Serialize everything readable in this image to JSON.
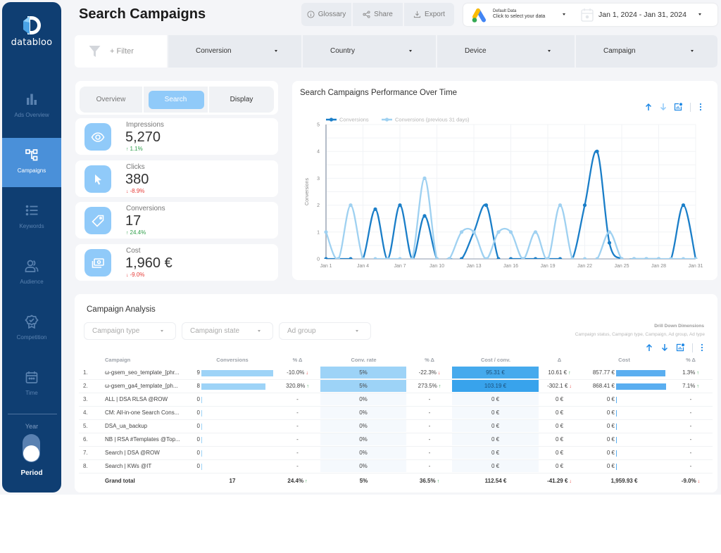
{
  "app": {
    "logo_text": "databloo"
  },
  "sidebar": {
    "items": [
      {
        "label": "Ads Overview",
        "icon": "bar-chart-icon",
        "active": false
      },
      {
        "label": "Campaigns",
        "icon": "hierarchy-icon",
        "active": true
      },
      {
        "label": "Keywords",
        "icon": "list-icon",
        "active": false
      },
      {
        "label": "Audience",
        "icon": "users-icon",
        "active": false
      },
      {
        "label": "Competition",
        "icon": "award-badge-icon",
        "active": false
      },
      {
        "label": "Time",
        "icon": "calendar-icon",
        "active": false
      }
    ],
    "toggle": {
      "top_label": "Year",
      "bottom_label": "Period",
      "selected": "Period"
    }
  },
  "header": {
    "title": "Search Campaigns",
    "buttons": [
      {
        "label": "Glossary",
        "icon": "info-icon"
      },
      {
        "label": "Share",
        "icon": "share-icon"
      },
      {
        "label": "Export",
        "icon": "download-icon"
      }
    ],
    "data_source": {
      "title": "Default Data",
      "subtitle": "Click to select your data",
      "icon": "google-ads-icon"
    },
    "date_range": "Jan 1, 2024 - Jan 31, 2024"
  },
  "filters": {
    "add_filter": "+ Filter",
    "dropdowns": [
      "Conversion",
      "Country",
      "Device",
      "Campaign"
    ]
  },
  "tabs": {
    "items": [
      "Overview",
      "Search",
      "Display"
    ],
    "active": "Search"
  },
  "scorecards": [
    {
      "label": "Impressions",
      "value": "5,270",
      "delta": "1.1%",
      "direction": "up",
      "icon": "eye-icon"
    },
    {
      "label": "Clicks",
      "value": "380",
      "delta": "-8.9%",
      "direction": "down",
      "icon": "cursor-icon"
    },
    {
      "label": "Conversions",
      "value": "17",
      "delta": "24.4%",
      "direction": "up",
      "icon": "tag-icon"
    },
    {
      "label": "Cost",
      "value": "1,960 €",
      "delta": "-9.0%",
      "direction": "down",
      "icon": "money-icon"
    }
  ],
  "chart_data": {
    "type": "line",
    "title": "Search Campaigns Performance Over Time",
    "xlabel": "",
    "ylabel": "Conversions",
    "x": [
      "Jan 1",
      "Jan 2",
      "Jan 3",
      "Jan 4",
      "Jan 5",
      "Jan 6",
      "Jan 7",
      "Jan 8",
      "Jan 9",
      "Jan 10",
      "Jan 11",
      "Jan 12",
      "Jan 13",
      "Jan 14",
      "Jan 15",
      "Jan 16",
      "Jan 17",
      "Jan 18",
      "Jan 19",
      "Jan 20",
      "Jan 21",
      "Jan 22",
      "Jan 23",
      "Jan 24",
      "Jan 25",
      "Jan 26",
      "Jan 27",
      "Jan 28",
      "Jan 29",
      "Jan 30",
      "Jan 31"
    ],
    "x_tick_labels": [
      "Jan 1",
      "Jan 4",
      "Jan 7",
      "Jan 10",
      "Jan 13",
      "Jan 16",
      "Jan 19",
      "Jan 22",
      "Jan 25",
      "Jan 28",
      "Jan 31"
    ],
    "y_ticks": [
      0,
      1,
      2,
      3,
      4,
      5
    ],
    "ylim": [
      0,
      5
    ],
    "grid": true,
    "legend": "top-left",
    "series": [
      {
        "name": "Conversions",
        "color": "#1a7ec8",
        "values": [
          0,
          0,
          0,
          0,
          1.85,
          0,
          2,
          0,
          1.6,
          0,
          0,
          0,
          1,
          2,
          0,
          0,
          0,
          0,
          0,
          0,
          0,
          2,
          4,
          0.6,
          0,
          0,
          0,
          0,
          0,
          2,
          0
        ]
      },
      {
        "name": "Conversions (previous 31 days)",
        "color": "#9fd1f1",
        "values": [
          1,
          0,
          2,
          0,
          0,
          0,
          0,
          0,
          3,
          0,
          0,
          1,
          1,
          0,
          1,
          1,
          0,
          1,
          0,
          2,
          0,
          0,
          0,
          1,
          0,
          0,
          0,
          0,
          0,
          0,
          0
        ]
      }
    ]
  },
  "table": {
    "title": "Campaign Analysis",
    "filters": [
      "Campaign type",
      "Campaign state",
      "Ad group"
    ],
    "drilldown_title": "Drill Down Dimensions",
    "drilldown_dims": "Campaign status, Campaign type, Campaign, Ad group, Ad type",
    "columns": [
      "Campaign",
      "Conversions",
      "% Δ",
      "Conv. rate",
      "% Δ",
      "Cost / conv.",
      "Δ",
      "Cost",
      "% Δ"
    ],
    "heat": {
      "conv_rate": {
        "low": "#f5f9fd",
        "high": "#9dd3f7"
      },
      "cost_per_conv": {
        "low": "#f5f9fd",
        "high": "#38a3ec"
      }
    },
    "bar_colors": {
      "conversions": "#9dd3f7",
      "cost": "#5aaef0"
    },
    "rows": [
      {
        "index": "1.",
        "campaign": "ω-gsem_seo_template_[phr...",
        "conversions": 9,
        "conv_delta": "-10.0%",
        "conv_delta_dir": "down",
        "conv_rate": "5%",
        "conv_rate_value": 5,
        "conv_rate_delta": "-22.3%",
        "conv_rate_delta_dir": "down",
        "cost_per_conv": "95.31 €",
        "cost_per_conv_value": 95.31,
        "cost_per_conv_delta": "10.61 €",
        "cost_per_conv_delta_dir": "up",
        "cost": "857.77 €",
        "cost_value": 857.77,
        "cost_delta": "1.3%",
        "cost_delta_dir": "up"
      },
      {
        "index": "2.",
        "campaign": "ω-gsem_ga4_template_[ph...",
        "conversions": 8,
        "conv_delta": "320.8%",
        "conv_delta_dir": "up",
        "conv_rate": "5%",
        "conv_rate_value": 5,
        "conv_rate_delta": "273.5%",
        "conv_rate_delta_dir": "up",
        "cost_per_conv": "103.19 €",
        "cost_per_conv_value": 103.19,
        "cost_per_conv_delta": "-302.1 €",
        "cost_per_conv_delta_dir": "down",
        "cost": "868.41 €",
        "cost_value": 868.41,
        "cost_delta": "7.1%",
        "cost_delta_dir": "up"
      },
      {
        "index": "3.",
        "campaign": "ALL | DSA RLSA @ROW",
        "conversions": 0,
        "conv_delta": "-",
        "conv_delta_dir": "",
        "conv_rate": "0%",
        "conv_rate_value": 0,
        "conv_rate_delta": "-",
        "conv_rate_delta_dir": "",
        "cost_per_conv": "0 €",
        "cost_per_conv_value": 0,
        "cost_per_conv_delta": "0 €",
        "cost_per_conv_delta_dir": "",
        "cost": "0 €",
        "cost_value": 0,
        "cost_delta": "-",
        "cost_delta_dir": ""
      },
      {
        "index": "4.",
        "campaign": "CM: All-in-one Search Cons...",
        "conversions": 0,
        "conv_delta": "-",
        "conv_delta_dir": "",
        "conv_rate": "0%",
        "conv_rate_value": 0,
        "conv_rate_delta": "-",
        "conv_rate_delta_dir": "",
        "cost_per_conv": "0 €",
        "cost_per_conv_value": 0,
        "cost_per_conv_delta": "0 €",
        "cost_per_conv_delta_dir": "",
        "cost": "0 €",
        "cost_value": 0,
        "cost_delta": "-",
        "cost_delta_dir": ""
      },
      {
        "index": "5.",
        "campaign": "DSA_ua_backup",
        "conversions": 0,
        "conv_delta": "-",
        "conv_delta_dir": "",
        "conv_rate": "0%",
        "conv_rate_value": 0,
        "conv_rate_delta": "-",
        "conv_rate_delta_dir": "",
        "cost_per_conv": "0 €",
        "cost_per_conv_value": 0,
        "cost_per_conv_delta": "0 €",
        "cost_per_conv_delta_dir": "",
        "cost": "0 €",
        "cost_value": 0,
        "cost_delta": "-",
        "cost_delta_dir": ""
      },
      {
        "index": "6.",
        "campaign": "NB | RSA #Templates @Top...",
        "conversions": 0,
        "conv_delta": "-",
        "conv_delta_dir": "",
        "conv_rate": "0%",
        "conv_rate_value": 0,
        "conv_rate_delta": "-",
        "conv_rate_delta_dir": "",
        "cost_per_conv": "0 €",
        "cost_per_conv_value": 0,
        "cost_per_conv_delta": "0 €",
        "cost_per_conv_delta_dir": "",
        "cost": "0 €",
        "cost_value": 0,
        "cost_delta": "-",
        "cost_delta_dir": ""
      },
      {
        "index": "7.",
        "campaign": "Search | DSA @ROW",
        "conversions": 0,
        "conv_delta": "-",
        "conv_delta_dir": "",
        "conv_rate": "0%",
        "conv_rate_value": 0,
        "conv_rate_delta": "-",
        "conv_rate_delta_dir": "",
        "cost_per_conv": "0 €",
        "cost_per_conv_value": 0,
        "cost_per_conv_delta": "0 €",
        "cost_per_conv_delta_dir": "",
        "cost": "0 €",
        "cost_value": 0,
        "cost_delta": "-",
        "cost_delta_dir": ""
      },
      {
        "index": "8.",
        "campaign": "Search | KWs @IT",
        "conversions": 0,
        "conv_delta": "-",
        "conv_delta_dir": "",
        "conv_rate": "0%",
        "conv_rate_value": 0,
        "conv_rate_delta": "-",
        "conv_rate_delta_dir": "",
        "cost_per_conv": "0 €",
        "cost_per_conv_value": 0,
        "cost_per_conv_delta": "0 €",
        "cost_per_conv_delta_dir": "",
        "cost": "0 €",
        "cost_value": 0,
        "cost_delta": "-",
        "cost_delta_dir": ""
      }
    ],
    "total": {
      "label": "Grand total",
      "conversions": "17",
      "conv_delta": "24.4%",
      "conv_delta_dir": "up",
      "conv_rate": "5%",
      "conv_rate_delta": "36.5%",
      "conv_rate_delta_dir": "up",
      "cost_per_conv": "112.54 €",
      "cost_per_conv_delta": "-41.29 €",
      "cost_per_conv_delta_dir": "down",
      "cost": "1,959.93 €",
      "cost_delta": "-9.0%",
      "cost_delta_dir": "down"
    }
  },
  "colors": {
    "sidebar_bg": "#0f3e72",
    "sidebar_active": "#4a90d9",
    "accent_light": "#90caf9",
    "positive": "#2e9e4a",
    "negative": "#e53935"
  }
}
